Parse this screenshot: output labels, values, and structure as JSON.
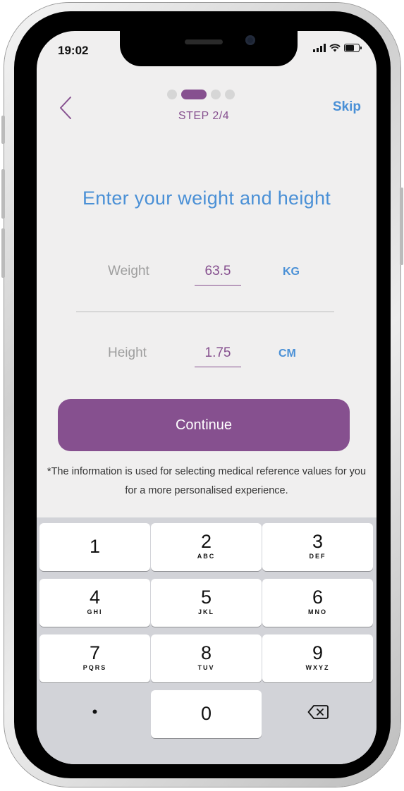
{
  "status_bar": {
    "time": "19:02",
    "battery_level": 0.75
  },
  "header": {
    "back_icon": "chevron-left-icon",
    "step_label": "STEP 2/4",
    "total_steps": 4,
    "current_step": 2,
    "skip_label": "Skip"
  },
  "main": {
    "heading": "Enter your weight and height",
    "weight": {
      "label": "Weight",
      "value": "63.5",
      "unit": "KG"
    },
    "height": {
      "label": "Height",
      "value": "1.75",
      "unit": "CM"
    },
    "continue_label": "Continue",
    "disclaimer": "*The information is used for selecting medical reference values for you for a more personalised experience."
  },
  "keyboard": {
    "keys": [
      {
        "num": "1",
        "letters": ""
      },
      {
        "num": "2",
        "letters": "ABC"
      },
      {
        "num": "3",
        "letters": "DEF"
      },
      {
        "num": "4",
        "letters": "GHI"
      },
      {
        "num": "5",
        "letters": "JKL"
      },
      {
        "num": "6",
        "letters": "MNO"
      },
      {
        "num": "7",
        "letters": "PQRS"
      },
      {
        "num": "8",
        "letters": "TUV"
      },
      {
        "num": "9",
        "letters": "WXYZ"
      }
    ],
    "decimal": "•",
    "zero": "0",
    "delete_icon": "backspace-icon"
  },
  "colors": {
    "accent_purple": "#86508f",
    "accent_blue": "#4a90d6",
    "screen_bg": "#f0efef",
    "keyboard_bg": "#d2d3d8"
  }
}
